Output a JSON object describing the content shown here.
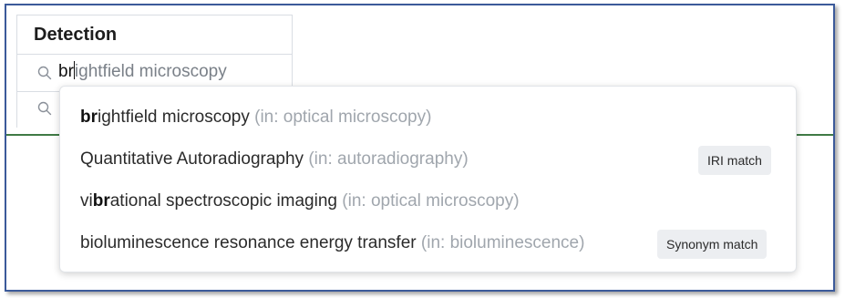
{
  "table": {
    "header": "Detection",
    "rows": [
      {
        "typed_prefix": "br",
        "placeholder_rest": "ightfield microscopy"
      },
      {
        "value": ""
      }
    ]
  },
  "dropdown": {
    "options": [
      {
        "pre": "",
        "match": "br",
        "post": "ightfield microscopy",
        "context": "(in: optical microscopy)",
        "badge": ""
      },
      {
        "pre": "Quantitative Autoradiography",
        "match": "",
        "post": "",
        "context": "(in: autoradiography)",
        "badge": "IRI match"
      },
      {
        "pre": "vi",
        "match": "br",
        "post": "ational spectroscopic imaging",
        "context": "(in: optical microscopy)",
        "badge": ""
      },
      {
        "pre": "bioluminescence resonance energy transfer",
        "match": "",
        "post": "",
        "context": "(in: bioluminescence)",
        "badge": "Synonym match"
      }
    ]
  },
  "colors": {
    "frame_border": "#3b5a9a",
    "divider": "#3f7a45",
    "context_text": "#a0a6ad",
    "badge_bg": "#eceef1"
  },
  "icons": {
    "search": "search-icon"
  }
}
